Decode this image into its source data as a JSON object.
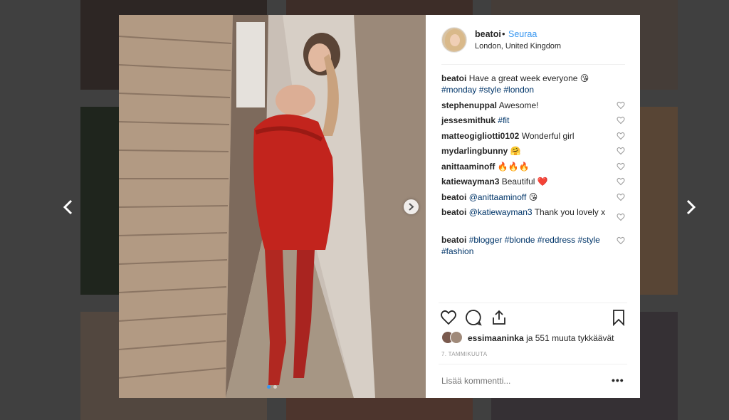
{
  "post": {
    "username": "beatoi",
    "separator": "•",
    "follow_label": "Seuraa",
    "location": "London, United Kingdom"
  },
  "comments": [
    {
      "user": "beatoi",
      "text": "Have a great week everyone 😘",
      "tags": "#monday #style #london"
    },
    {
      "user": "stephenuppal",
      "text": "Awesome!"
    },
    {
      "user": "jessesmithuk",
      "tags": "#fit"
    },
    {
      "user": "matteogigliotti0102",
      "text": "Wonderful girl"
    },
    {
      "user": "mydarlingbunny",
      "text": "🤗"
    },
    {
      "user": "anittaaminoff",
      "text": "🔥🔥🔥"
    },
    {
      "user": "katiewayman3",
      "text": "Beautiful ❤️"
    },
    {
      "user": "beatoi",
      "mention": "@anittaaminoff",
      "text": "😘"
    },
    {
      "user": "beatoi",
      "mention": "@katiewayman3",
      "text": "Thank you lovely x"
    },
    {
      "user": "beatoi",
      "tags": "#blogger #blonde #reddress #style #fashion"
    }
  ],
  "likes": {
    "liker": "essimaaninka",
    "rest": "ja 551 muuta tykkäävät"
  },
  "date": "7. TAMMIKUUTA",
  "add_comment_placeholder": "Lisää kommentti...",
  "more_label": "•••",
  "icons": {
    "prev": "chevron-left-icon",
    "next": "chevron-right-icon",
    "like": "heart-icon",
    "comment": "comment-icon",
    "share": "share-icon",
    "save": "bookmark-icon"
  },
  "colors": {
    "link": "#3897f0",
    "hashtag": "#003569",
    "text": "#262626",
    "muted": "#999999"
  }
}
